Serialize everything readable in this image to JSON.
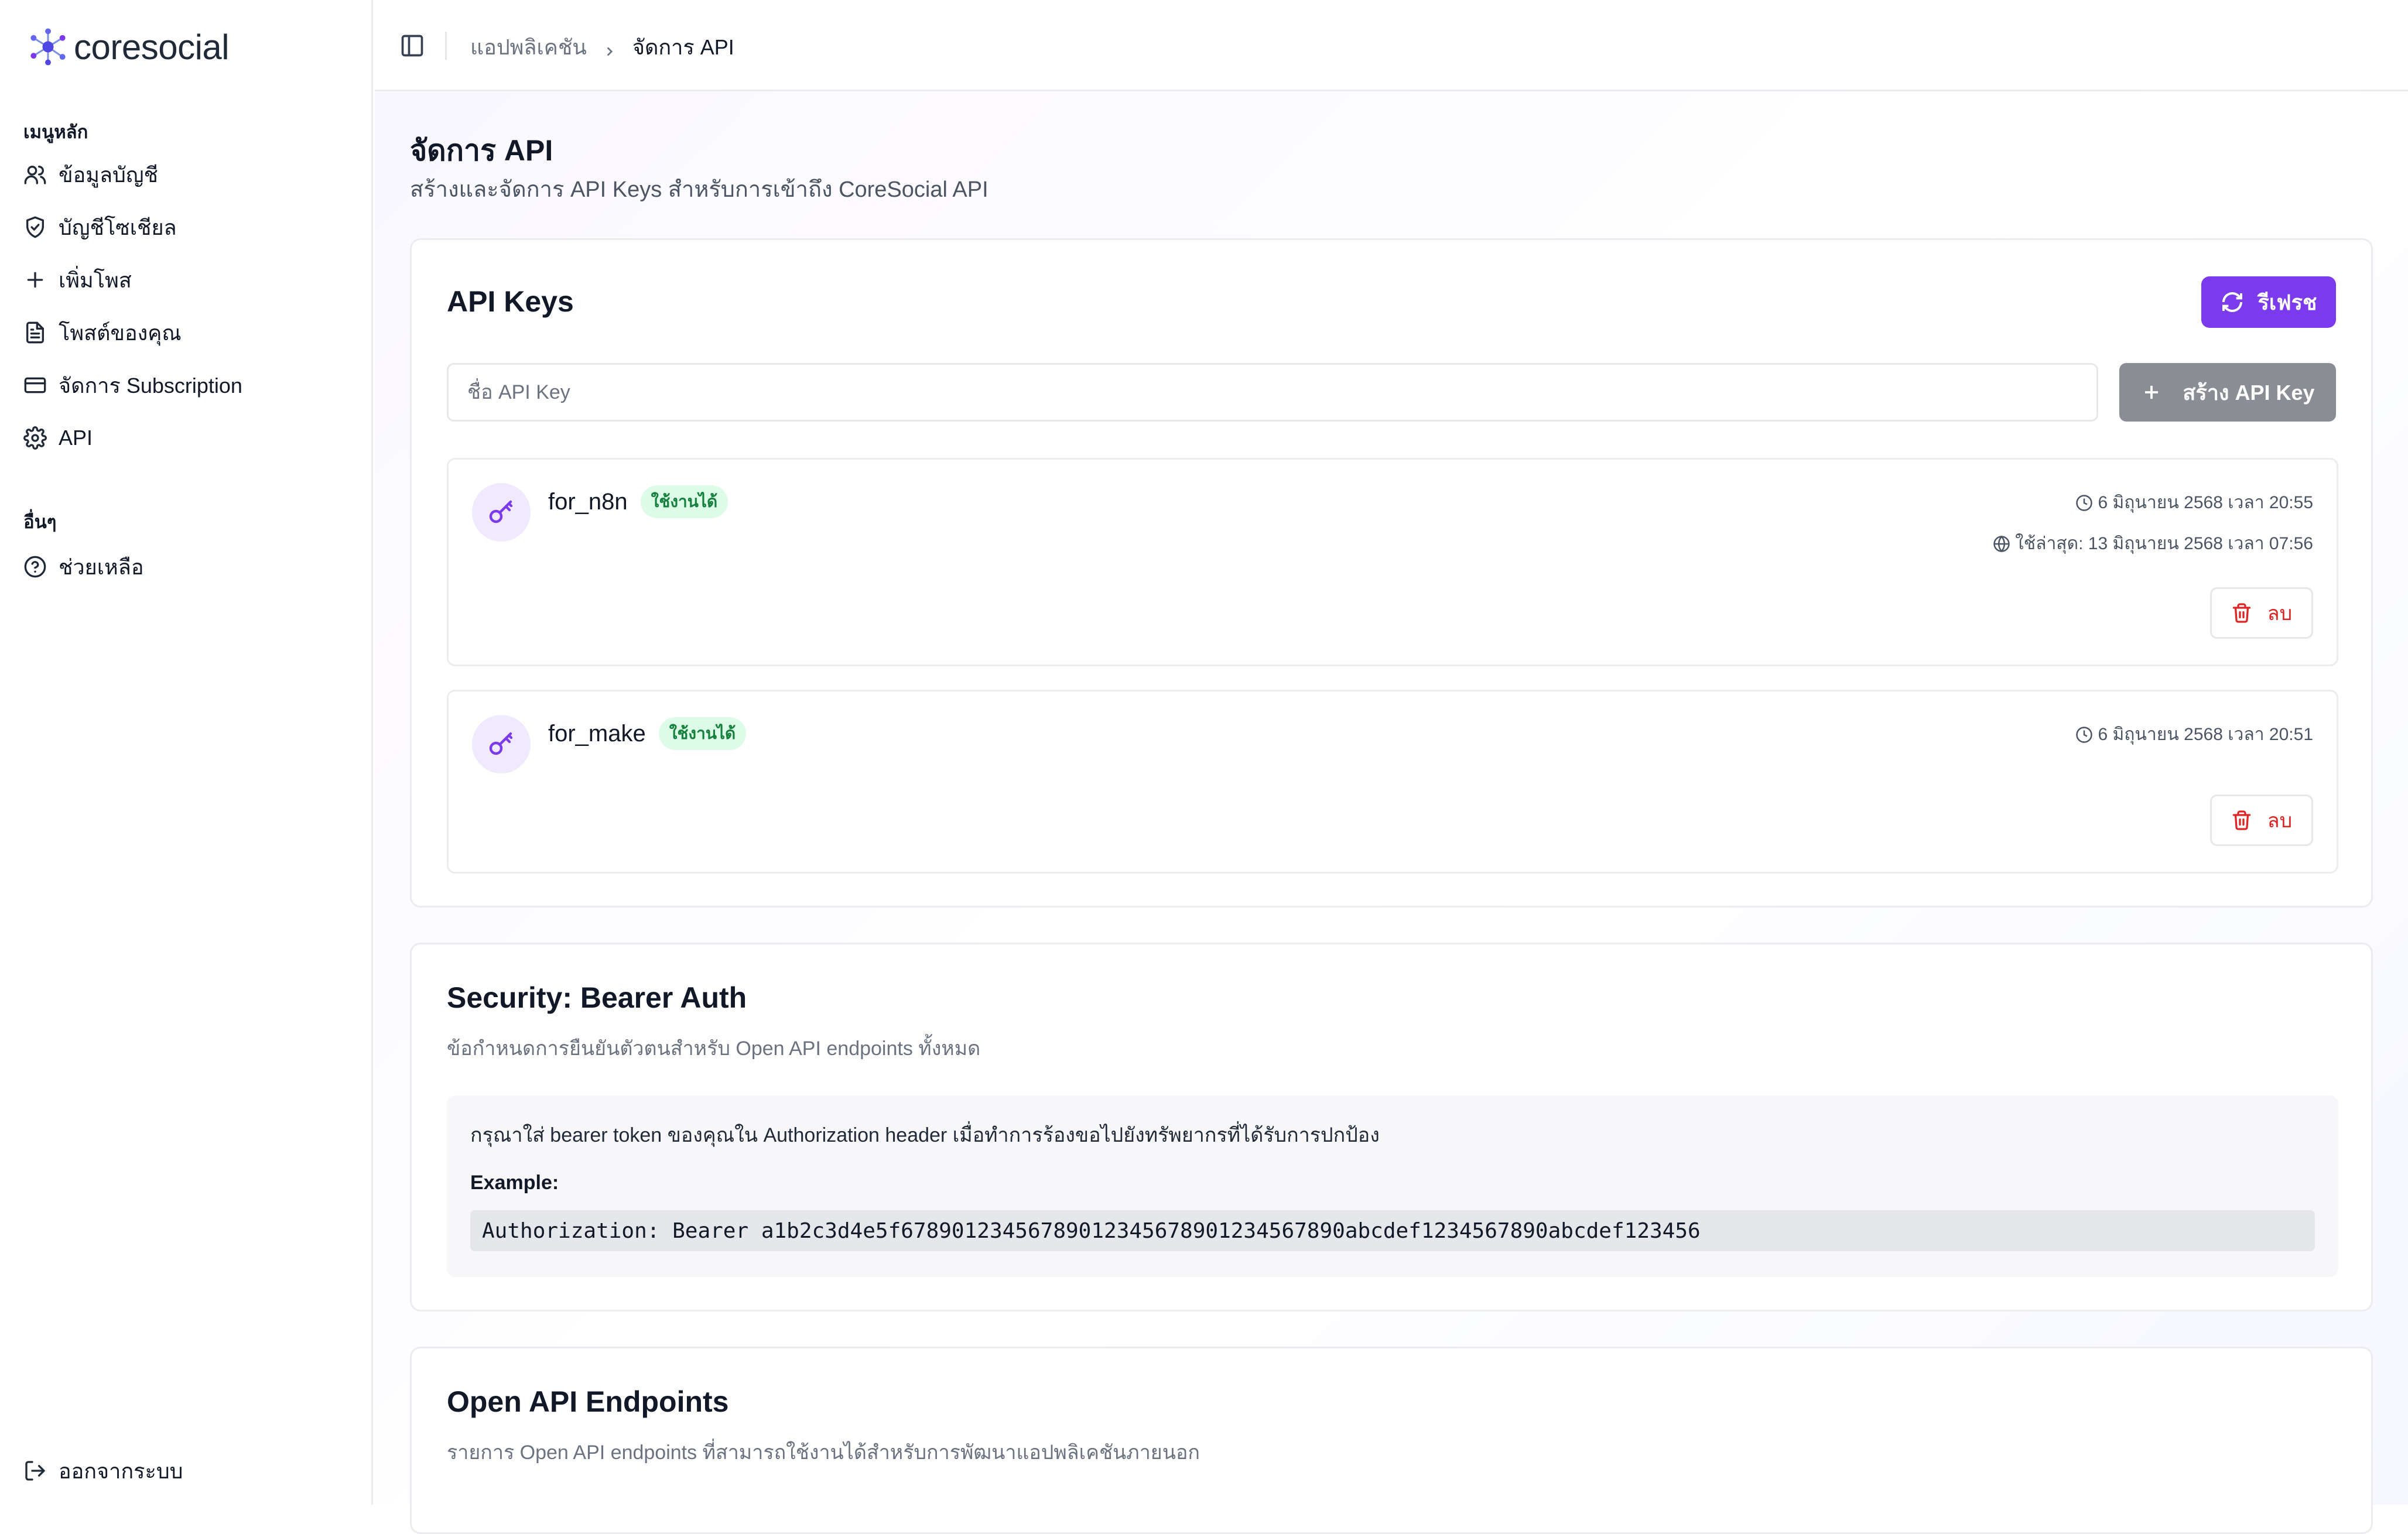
{
  "app": {
    "logo_text": "coresocial"
  },
  "sidebar": {
    "main_section_label": "เมนูหลัก",
    "main_items": [
      {
        "label": "ข้อมูลบัญชี",
        "icon": "users-icon"
      },
      {
        "label": "บัญชีโซเชียล",
        "icon": "shield-check-icon"
      },
      {
        "label": "เพิ่มโพส",
        "icon": "plus-icon"
      },
      {
        "label": "โพสต์ของคุณ",
        "icon": "document-icon"
      },
      {
        "label": "จัดการ Subscription",
        "icon": "credit-card-icon"
      },
      {
        "label": "API",
        "icon": "gear-icon"
      }
    ],
    "other_section_label": "อื่นๆ",
    "other_items": [
      {
        "label": "ช่วยเหลือ",
        "icon": "help-circle-icon"
      }
    ],
    "logout_label": "ออกจากระบบ"
  },
  "header": {
    "breadcrumb": {
      "parent": "แอปพลิเคชัน",
      "current": "จัดการ API"
    }
  },
  "page": {
    "title": "จัดการ API",
    "subtitle": "สร้างและจัดการ API Keys สำหรับการเข้าถึง CoreSocial API"
  },
  "api_keys": {
    "title": "API Keys",
    "refresh_label": "รีเฟรช",
    "input_placeholder": "ชื่อ API Key",
    "input_value": "",
    "create_label": "สร้าง API Key",
    "items": [
      {
        "name": "for_n8n",
        "status": "ใช้งานได้",
        "created": "6 มิถุนายน 2568 เวลา 20:55",
        "last_used": "ใช้ล่าสุด: 13 มิถุนายน 2568 เวลา 07:56",
        "delete_label": "ลบ"
      },
      {
        "name": "for_make",
        "status": "ใช้งานได้",
        "created": "6 มิถุนายน 2568 เวลา 20:51",
        "delete_label": "ลบ"
      }
    ]
  },
  "security": {
    "title": "Security: Bearer Auth",
    "description": "ข้อกำหนดการยืนยันตัวตนสำหรับ Open API endpoints ทั้งหมด",
    "instruction": "กรุณาใส่ bearer token ของคุณใน Authorization header เมื่อทำการร้องขอไปยังทรัพยากรที่ได้รับการปกป้อง",
    "example_label": "Example:",
    "example_code": "Authorization: Bearer a1b2c3d4e5f67890123456789012345678901234567890abcdef1234567890abcdef123456"
  },
  "endpoints": {
    "title": "Open API Endpoints",
    "description": "รายการ Open API endpoints ที่สามารถใช้งานได้สำหรับการพัฒนาแอปพลิเคชันภายนอก"
  },
  "colors": {
    "accent": "#7c3aed",
    "status_active_bg": "#dcfce7",
    "status_active_text": "#15803d",
    "danger": "#dc2626"
  }
}
